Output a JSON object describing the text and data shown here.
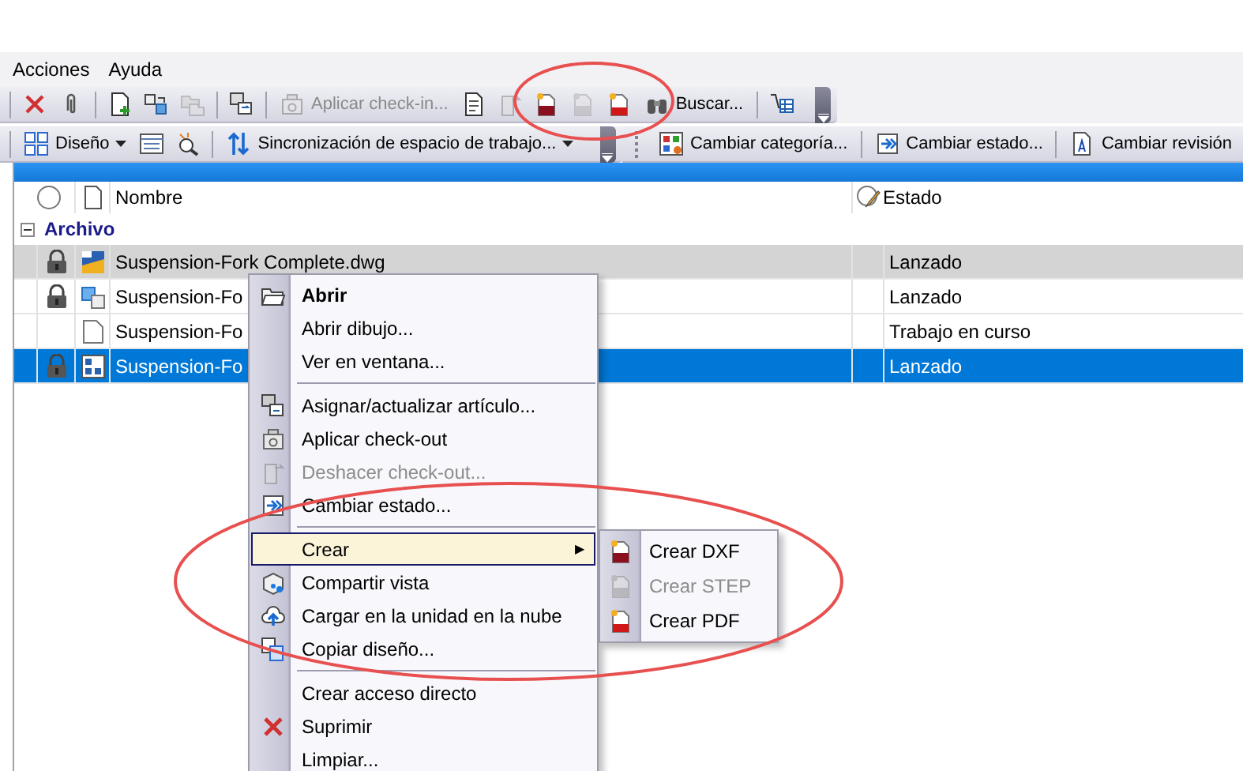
{
  "menu_bar": {
    "items": [
      "Acciones",
      "Ayuda"
    ]
  },
  "toolbar_1": [
    {
      "kind": "separator"
    },
    {
      "kind": "icon",
      "disabled": false
    },
    {
      "kind": "icon",
      "disabled": false
    },
    {
      "kind": "separator"
    },
    {
      "kind": "icon",
      "disabled": false
    },
    {
      "kind": "icon",
      "disabled": false
    },
    {
      "kind": "icon",
      "disabled": true
    },
    {
      "kind": "separator"
    },
    {
      "kind": "icon",
      "disabled": false
    },
    {
      "kind": "separator"
    },
    {
      "kind": "button",
      "label": "Aplicar check-in...",
      "disabled": true
    },
    {
      "kind": "icon",
      "disabled": false
    },
    {
      "kind": "icon",
      "disabled": true
    },
    {
      "kind": "icon",
      "disabled": false
    },
    {
      "kind": "icon",
      "disabled": true
    },
    {
      "kind": "icon",
      "disabled": false
    },
    {
      "kind": "button",
      "label": "Buscar...",
      "disabled": false
    },
    {
      "kind": "separator"
    },
    {
      "kind": "icon",
      "disabled": false
    }
  ],
  "toolbar_2": [
    {
      "kind": "separator"
    },
    {
      "kind": "dropdown",
      "label": "Diseño"
    },
    {
      "kind": "icon"
    },
    {
      "kind": "icon"
    },
    {
      "kind": "separator"
    },
    {
      "kind": "dropdown",
      "label": "Sincronización de espacio de trabajo..."
    }
  ],
  "toolbar_3": [
    {
      "kind": "button",
      "label": "Cambiar categoría..."
    },
    {
      "kind": "separator"
    },
    {
      "kind": "button",
      "label": "Cambiar estado..."
    },
    {
      "kind": "separator"
    },
    {
      "kind": "button",
      "label": "Cambiar revisión"
    }
  ],
  "table": {
    "columns": [
      "Nombre",
      "Estado"
    ],
    "group": {
      "label": "Archivo",
      "expanded": true
    },
    "rows": [
      {
        "name": "Suspension-Fork Complete.dwg",
        "status": "Lanzado",
        "locked": true,
        "selected": false,
        "hovered": true
      },
      {
        "name": "Suspension-Fo",
        "status": "Lanzado",
        "locked": true,
        "selected": false,
        "hovered": false
      },
      {
        "name": "Suspension-Fo",
        "status": "Trabajo en curso",
        "locked": false,
        "selected": false,
        "hovered": false
      },
      {
        "name": "Suspension-Fo",
        "status": "Lanzado",
        "locked": true,
        "selected": true,
        "hovered": false
      }
    ]
  },
  "context_menu": [
    {
      "kind": "item",
      "label": "Abrir",
      "bold": true,
      "disabled": false
    },
    {
      "kind": "item",
      "label": "Abrir dibujo...",
      "bold": false,
      "disabled": false
    },
    {
      "kind": "item",
      "label": "Ver en ventana...",
      "bold": false,
      "disabled": false
    },
    {
      "kind": "separator"
    },
    {
      "kind": "item",
      "label": "Asignar/actualizar artículo...",
      "bold": false,
      "disabled": false
    },
    {
      "kind": "item",
      "label": "Aplicar check-out",
      "bold": false,
      "disabled": false
    },
    {
      "kind": "item",
      "label": "Deshacer check-out...",
      "bold": false,
      "disabled": true
    },
    {
      "kind": "item",
      "label": "Cambiar estado...",
      "bold": false,
      "disabled": false
    },
    {
      "kind": "separator"
    },
    {
      "kind": "submenu",
      "label": "Crear",
      "bold": false,
      "disabled": false,
      "selected": true,
      "arrow": "▶"
    },
    {
      "kind": "item",
      "label": "Compartir vista",
      "bold": false,
      "disabled": false
    },
    {
      "kind": "item",
      "label": "Cargar en la unidad en la nube",
      "bold": false,
      "disabled": false
    },
    {
      "kind": "item",
      "label": "Copiar diseño...",
      "bold": false,
      "disabled": false
    },
    {
      "kind": "separator"
    },
    {
      "kind": "item",
      "label": "Crear acceso directo",
      "bold": false,
      "disabled": false
    },
    {
      "kind": "item",
      "label": "Suprimir",
      "bold": false,
      "disabled": false
    },
    {
      "kind": "item",
      "label": "Limpiar...",
      "bold": false,
      "disabled": false
    }
  ],
  "submenu": [
    {
      "label": "Crear DXF",
      "disabled": false
    },
    {
      "label": "Crear STEP",
      "disabled": true
    },
    {
      "label": "Crear PDF",
      "disabled": false
    }
  ]
}
